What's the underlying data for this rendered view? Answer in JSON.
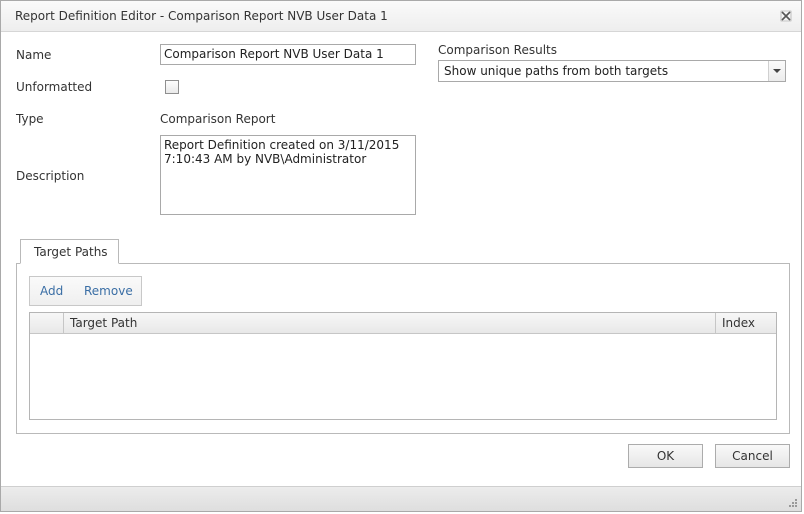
{
  "window": {
    "title": "Report Definition Editor - Comparison Report NVB User Data 1"
  },
  "form": {
    "name_label": "Name",
    "name_value": "Comparison Report NVB User Data 1",
    "unformatted_label": "Unformatted",
    "unformatted_checked": false,
    "type_label": "Type",
    "type_value": "Comparison Report",
    "description_label": "Description",
    "description_value": "Report Definition created on 3/11/2015\n7:10:43 AM by NVB\\Administrator",
    "comparison_label": "Comparison Results",
    "comparison_value": "Show unique paths from both targets"
  },
  "tabs": [
    {
      "label": "Target Paths"
    }
  ],
  "toolbar": {
    "add_label": "Add",
    "remove_label": "Remove"
  },
  "grid": {
    "columns": [
      "",
      "Target Path",
      "Index"
    ],
    "rows": []
  },
  "buttons": {
    "ok_label": "OK",
    "cancel_label": "Cancel"
  },
  "icons": {
    "close": "close-icon",
    "dropdown": "chevron-down-icon",
    "grip": "resize-grip-icon"
  }
}
